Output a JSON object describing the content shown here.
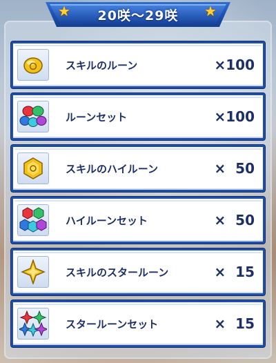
{
  "header": {
    "title": "20咲〜29咲"
  },
  "rewards": [
    {
      "name": "スキルのルーン",
      "quantity": "×100",
      "icon": "skill-rune-icon"
    },
    {
      "name": "ルーンセット",
      "quantity": "×100",
      "icon": "rune-set-icon"
    },
    {
      "name": "スキルのハイルーン",
      "quantity": "×  50",
      "icon": "skill-high-rune-icon"
    },
    {
      "name": "ハイルーンセット",
      "quantity": "×  50",
      "icon": "high-rune-set-icon"
    },
    {
      "name": "スキルのスタールーン",
      "quantity": "×  15",
      "icon": "skill-star-rune-icon"
    },
    {
      "name": "スタールーンセット",
      "quantity": "×  15",
      "icon": "star-rune-set-icon"
    }
  ],
  "colors": {
    "banner": "#1b4fae",
    "frame": "#1f4fa8",
    "text": "#1c2f66",
    "star": "#ffd23a"
  }
}
